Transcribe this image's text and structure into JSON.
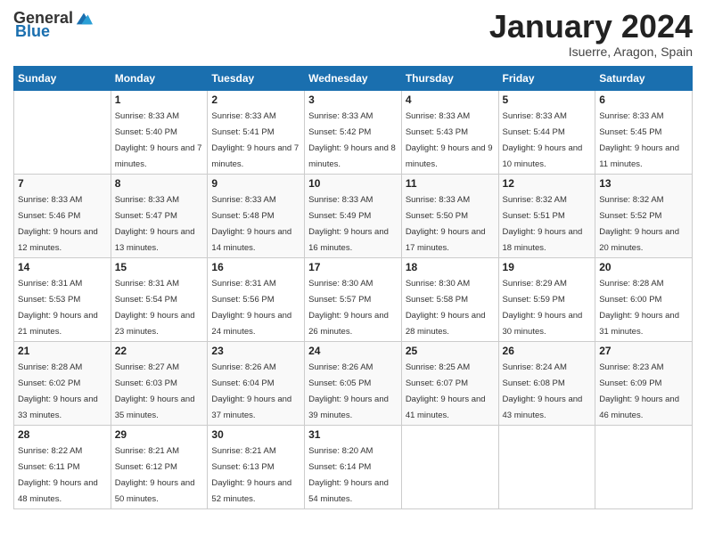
{
  "logo": {
    "text_general": "General",
    "text_blue": "Blue"
  },
  "header": {
    "month_title": "January 2024",
    "subtitle": "Isuerre, Aragon, Spain"
  },
  "days_of_week": [
    "Sunday",
    "Monday",
    "Tuesday",
    "Wednesday",
    "Thursday",
    "Friday",
    "Saturday"
  ],
  "weeks": [
    [
      {
        "num": "",
        "sunrise": "",
        "sunset": "",
        "daylight": ""
      },
      {
        "num": "1",
        "sunrise": "Sunrise: 8:33 AM",
        "sunset": "Sunset: 5:40 PM",
        "daylight": "Daylight: 9 hours and 7 minutes."
      },
      {
        "num": "2",
        "sunrise": "Sunrise: 8:33 AM",
        "sunset": "Sunset: 5:41 PM",
        "daylight": "Daylight: 9 hours and 7 minutes."
      },
      {
        "num": "3",
        "sunrise": "Sunrise: 8:33 AM",
        "sunset": "Sunset: 5:42 PM",
        "daylight": "Daylight: 9 hours and 8 minutes."
      },
      {
        "num": "4",
        "sunrise": "Sunrise: 8:33 AM",
        "sunset": "Sunset: 5:43 PM",
        "daylight": "Daylight: 9 hours and 9 minutes."
      },
      {
        "num": "5",
        "sunrise": "Sunrise: 8:33 AM",
        "sunset": "Sunset: 5:44 PM",
        "daylight": "Daylight: 9 hours and 10 minutes."
      },
      {
        "num": "6",
        "sunrise": "Sunrise: 8:33 AM",
        "sunset": "Sunset: 5:45 PM",
        "daylight": "Daylight: 9 hours and 11 minutes."
      }
    ],
    [
      {
        "num": "7",
        "sunrise": "Sunrise: 8:33 AM",
        "sunset": "Sunset: 5:46 PM",
        "daylight": "Daylight: 9 hours and 12 minutes."
      },
      {
        "num": "8",
        "sunrise": "Sunrise: 8:33 AM",
        "sunset": "Sunset: 5:47 PM",
        "daylight": "Daylight: 9 hours and 13 minutes."
      },
      {
        "num": "9",
        "sunrise": "Sunrise: 8:33 AM",
        "sunset": "Sunset: 5:48 PM",
        "daylight": "Daylight: 9 hours and 14 minutes."
      },
      {
        "num": "10",
        "sunrise": "Sunrise: 8:33 AM",
        "sunset": "Sunset: 5:49 PM",
        "daylight": "Daylight: 9 hours and 16 minutes."
      },
      {
        "num": "11",
        "sunrise": "Sunrise: 8:33 AM",
        "sunset": "Sunset: 5:50 PM",
        "daylight": "Daylight: 9 hours and 17 minutes."
      },
      {
        "num": "12",
        "sunrise": "Sunrise: 8:32 AM",
        "sunset": "Sunset: 5:51 PM",
        "daylight": "Daylight: 9 hours and 18 minutes."
      },
      {
        "num": "13",
        "sunrise": "Sunrise: 8:32 AM",
        "sunset": "Sunset: 5:52 PM",
        "daylight": "Daylight: 9 hours and 20 minutes."
      }
    ],
    [
      {
        "num": "14",
        "sunrise": "Sunrise: 8:31 AM",
        "sunset": "Sunset: 5:53 PM",
        "daylight": "Daylight: 9 hours and 21 minutes."
      },
      {
        "num": "15",
        "sunrise": "Sunrise: 8:31 AM",
        "sunset": "Sunset: 5:54 PM",
        "daylight": "Daylight: 9 hours and 23 minutes."
      },
      {
        "num": "16",
        "sunrise": "Sunrise: 8:31 AM",
        "sunset": "Sunset: 5:56 PM",
        "daylight": "Daylight: 9 hours and 24 minutes."
      },
      {
        "num": "17",
        "sunrise": "Sunrise: 8:30 AM",
        "sunset": "Sunset: 5:57 PM",
        "daylight": "Daylight: 9 hours and 26 minutes."
      },
      {
        "num": "18",
        "sunrise": "Sunrise: 8:30 AM",
        "sunset": "Sunset: 5:58 PM",
        "daylight": "Daylight: 9 hours and 28 minutes."
      },
      {
        "num": "19",
        "sunrise": "Sunrise: 8:29 AM",
        "sunset": "Sunset: 5:59 PM",
        "daylight": "Daylight: 9 hours and 30 minutes."
      },
      {
        "num": "20",
        "sunrise": "Sunrise: 8:28 AM",
        "sunset": "Sunset: 6:00 PM",
        "daylight": "Daylight: 9 hours and 31 minutes."
      }
    ],
    [
      {
        "num": "21",
        "sunrise": "Sunrise: 8:28 AM",
        "sunset": "Sunset: 6:02 PM",
        "daylight": "Daylight: 9 hours and 33 minutes."
      },
      {
        "num": "22",
        "sunrise": "Sunrise: 8:27 AM",
        "sunset": "Sunset: 6:03 PM",
        "daylight": "Daylight: 9 hours and 35 minutes."
      },
      {
        "num": "23",
        "sunrise": "Sunrise: 8:26 AM",
        "sunset": "Sunset: 6:04 PM",
        "daylight": "Daylight: 9 hours and 37 minutes."
      },
      {
        "num": "24",
        "sunrise": "Sunrise: 8:26 AM",
        "sunset": "Sunset: 6:05 PM",
        "daylight": "Daylight: 9 hours and 39 minutes."
      },
      {
        "num": "25",
        "sunrise": "Sunrise: 8:25 AM",
        "sunset": "Sunset: 6:07 PM",
        "daylight": "Daylight: 9 hours and 41 minutes."
      },
      {
        "num": "26",
        "sunrise": "Sunrise: 8:24 AM",
        "sunset": "Sunset: 6:08 PM",
        "daylight": "Daylight: 9 hours and 43 minutes."
      },
      {
        "num": "27",
        "sunrise": "Sunrise: 8:23 AM",
        "sunset": "Sunset: 6:09 PM",
        "daylight": "Daylight: 9 hours and 46 minutes."
      }
    ],
    [
      {
        "num": "28",
        "sunrise": "Sunrise: 8:22 AM",
        "sunset": "Sunset: 6:11 PM",
        "daylight": "Daylight: 9 hours and 48 minutes."
      },
      {
        "num": "29",
        "sunrise": "Sunrise: 8:21 AM",
        "sunset": "Sunset: 6:12 PM",
        "daylight": "Daylight: 9 hours and 50 minutes."
      },
      {
        "num": "30",
        "sunrise": "Sunrise: 8:21 AM",
        "sunset": "Sunset: 6:13 PM",
        "daylight": "Daylight: 9 hours and 52 minutes."
      },
      {
        "num": "31",
        "sunrise": "Sunrise: 8:20 AM",
        "sunset": "Sunset: 6:14 PM",
        "daylight": "Daylight: 9 hours and 54 minutes."
      },
      {
        "num": "",
        "sunrise": "",
        "sunset": "",
        "daylight": ""
      },
      {
        "num": "",
        "sunrise": "",
        "sunset": "",
        "daylight": ""
      },
      {
        "num": "",
        "sunrise": "",
        "sunset": "",
        "daylight": ""
      }
    ]
  ]
}
